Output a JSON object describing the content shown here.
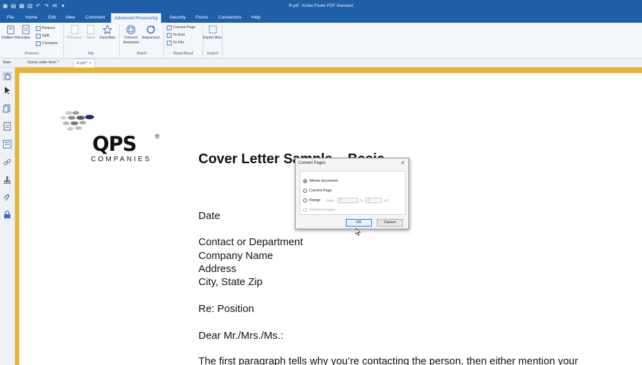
{
  "window": {
    "title": "R.pdf - Kofax Power PDF Standard"
  },
  "menu": {
    "tabs": [
      "File",
      "Home",
      "Edit",
      "View",
      "Comment",
      "Advanced Processing",
      "Security",
      "Forms",
      "Connectors",
      "Help"
    ],
    "active": "Advanced Processing"
  },
  "ribbon": {
    "flatten_file": "Flatten File",
    "index": "Index",
    "reduce": "Reduce",
    "split": "Split",
    "compare": "Compare",
    "previous": "Previous",
    "next": "Next",
    "favorites": "Favorites",
    "convert_assistant": "Convert Assistant",
    "sequencer": "Sequencer",
    "current_page": "Current Page",
    "to_end": "To End",
    "to_file": "To File",
    "export_area": "Export Area",
    "groups": {
      "process": "Process",
      "file": "File",
      "batch": "Batch",
      "read_aloud": "Read Aloud",
      "export": "Export"
    }
  },
  "doc_tabs": {
    "start": "Start",
    "donut": "Donut order form *",
    "rpdf": "R.pdf *",
    "close": "×"
  },
  "document": {
    "logo_text": "QPS",
    "logo_reg": "®",
    "logo_sub": "COMPANIES",
    "heading": "Cover Letter Sample – Basic",
    "lines": {
      "date": "Date",
      "contact": "Contact or Department",
      "company": "Company Name",
      "address": "Address",
      "city": "City, State Zip",
      "re": "Re:  Position",
      "greeting": "Dear Mr./Mrs./Ms.:",
      "para": "The first paragraph tells why you’re contacting the person, then either mention your"
    }
  },
  "dialog": {
    "title": "Convert Pages",
    "close": "×",
    "whole_document": "Whole document",
    "current_page": "Current Page",
    "range": "Range",
    "from_label": "From",
    "from_value": "1",
    "to_label": "To",
    "to_value": "1",
    "of_label": "of 1",
    "selected_pages": "Selected pages",
    "ok": "OK",
    "cancel": "Cancel",
    "selected_option": "Whole document"
  },
  "colors": {
    "accent": "#1e5fa8",
    "workspace": "#e9b332",
    "logo_dark": "#1f2a6b"
  }
}
